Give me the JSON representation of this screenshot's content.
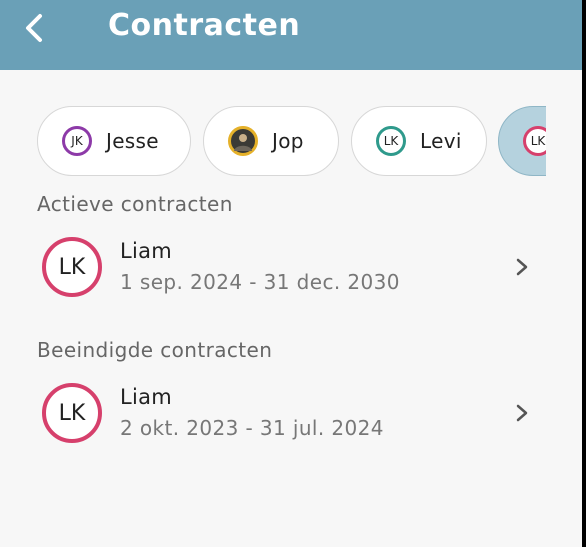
{
  "header": {
    "title": "Contracten"
  },
  "chips": [
    {
      "initials": "JK",
      "name": "Jesse",
      "ring": "#8d3aa8",
      "photo": false,
      "selected": false
    },
    {
      "initials": "",
      "name": "Jop",
      "ring": "#e5b12a",
      "photo": true,
      "selected": false
    },
    {
      "initials": "LK",
      "name": "Levi",
      "ring": "#2f9a8c",
      "photo": false,
      "selected": false
    },
    {
      "initials": "LK",
      "name": "",
      "ring": "#d6406c",
      "photo": false,
      "selected": true
    }
  ],
  "sections": {
    "active_label": "Actieve contracten",
    "ended_label": "Beeindigde contracten"
  },
  "active_contracts": [
    {
      "initials": "LK",
      "name": "Liam",
      "dates": "1 sep. 2024 - 31 dec. 2030"
    }
  ],
  "ended_contracts": [
    {
      "initials": "LK",
      "name": "Liam",
      "dates": "2 okt. 2023 - 31 jul. 2024"
    }
  ],
  "colors": {
    "header_bg": "#6aa0b7",
    "accent_ring": "#d6406c",
    "selected_chip": "#b5d2de"
  }
}
